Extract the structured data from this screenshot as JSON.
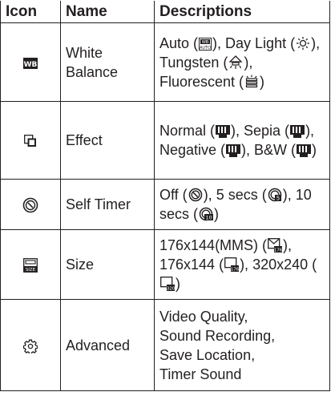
{
  "header": {
    "icon": "Icon",
    "name": "Name",
    "descriptions": "Descriptions"
  },
  "rows": [
    {
      "icon": "white-balance-icon",
      "name": "White Balance",
      "desc": [
        {
          "text": "Auto (",
          "icon": "wb-auto-icon",
          "after": "), "
        },
        {
          "text": "Day Light (",
          "icon": "daylight-icon",
          "after": "), "
        },
        {
          "text": "Tungsten (",
          "icon": "tungsten-icon",
          "after": "), "
        },
        {
          "text": "Fluorescent (",
          "icon": "fluorescent-icon",
          "after": ")"
        }
      ]
    },
    {
      "icon": "effect-icon",
      "name": "Effect",
      "desc": [
        {
          "text": "Normal (",
          "icon": "normal-effect-icon",
          "after": "), "
        },
        {
          "text": "Sepia (",
          "icon": "sepia-effect-icon",
          "after": "), "
        },
        {
          "text": "Negative (",
          "icon": "negative-effect-icon",
          "after": "), "
        },
        {
          "text": "B&W (",
          "icon": "bw-effect-icon",
          "after": ")"
        }
      ]
    },
    {
      "icon": "self-timer-icon",
      "name": "Self Timer",
      "desc": [
        {
          "text": "Off (",
          "icon": "timer-off-icon",
          "after": "), "
        },
        {
          "text": "5 secs (",
          "icon": "timer-5-icon",
          "after": "), "
        },
        {
          "text": "10 secs (",
          "icon": "timer-10-icon",
          "after": ")"
        }
      ]
    },
    {
      "icon": "size-icon",
      "name": "Size",
      "desc": [
        {
          "text": "176x144(MMS) (",
          "icon": "size-mms-icon",
          "after": "), "
        },
        {
          "text": "176x144 (",
          "icon": "size-176-icon",
          "after": "), "
        },
        {
          "text": "320x240 (",
          "icon": "size-320-icon",
          "after": ")"
        }
      ]
    },
    {
      "icon": "advanced-icon",
      "name": "Advanced",
      "desc_lines": [
        "Video Quality,",
        "Sound Recording,",
        "Save Location,",
        "Timer Sound"
      ]
    }
  ]
}
